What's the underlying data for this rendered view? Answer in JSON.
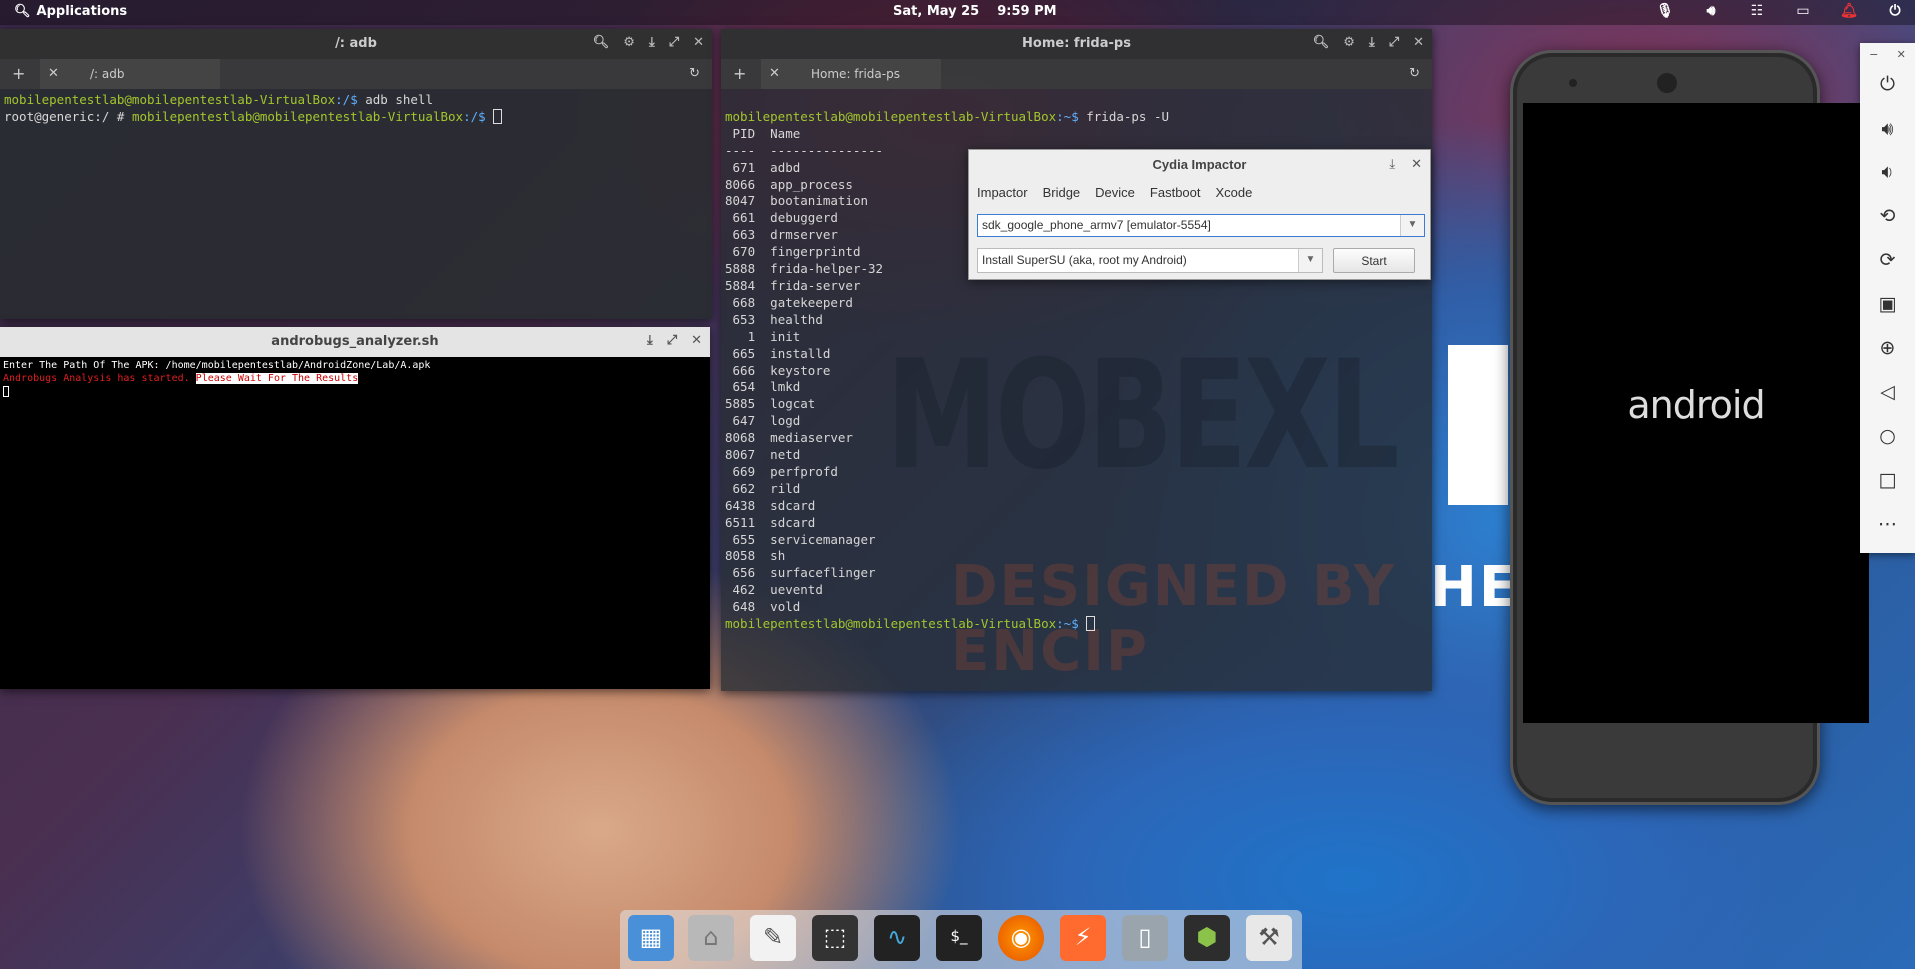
{
  "top_panel": {
    "applications": "Applications",
    "date": "Sat, May 25",
    "time": "9:59 PM",
    "indicators": [
      "mic-icon",
      "volume-icon",
      "network-icon",
      "battery-icon",
      "notifications-icon",
      "power-icon"
    ]
  },
  "adb_window": {
    "title": "/: adb",
    "tab_label": "/: adb",
    "lines": [
      {
        "prompt": "mobilepentestlab@mobilepentestlab-VirtualBox",
        "path": ":/$",
        "cmd": " adb shell"
      },
      {
        "plain": "root@generic:/ # ",
        "prompt": "mobilepentestlab@mobilepentestlab-VirtualBox",
        "path": ":/$",
        "cmd": " "
      }
    ]
  },
  "androbugs_window": {
    "title": "androbugs_analyzer.sh",
    "line1": "Enter The Path Of The APK: /home/mobilepentestlab/AndroidZone/Lab/A.apk",
    "line2_red": "Androbugs Analysis has started.",
    "line2_hl": "Please Wait For The Results"
  },
  "frida_window": {
    "title": "Home: frida-ps",
    "tab_label": "Home: frida-ps",
    "prompt": "mobilepentestlab@mobilepentestlab-VirtualBox",
    "prompt_path": ":~$",
    "command": " frida-ps -U",
    "header": " PID  Name",
    "divider": "----  ---------------",
    "processes": [
      {
        "pid": " 671",
        "name": "adbd"
      },
      {
        "pid": "8066",
        "name": "app_process"
      },
      {
        "pid": "8047",
        "name": "bootanimation"
      },
      {
        "pid": " 661",
        "name": "debuggerd"
      },
      {
        "pid": " 663",
        "name": "drmserver"
      },
      {
        "pid": " 670",
        "name": "fingerprintd"
      },
      {
        "pid": "5888",
        "name": "frida-helper-32"
      },
      {
        "pid": "5884",
        "name": "frida-server"
      },
      {
        "pid": " 668",
        "name": "gatekeeperd"
      },
      {
        "pid": " 653",
        "name": "healthd"
      },
      {
        "pid": "   1",
        "name": "init"
      },
      {
        "pid": " 665",
        "name": "installd"
      },
      {
        "pid": " 666",
        "name": "keystore"
      },
      {
        "pid": " 654",
        "name": "lmkd"
      },
      {
        "pid": "5885",
        "name": "logcat"
      },
      {
        "pid": " 647",
        "name": "logd"
      },
      {
        "pid": "8068",
        "name": "mediaserver"
      },
      {
        "pid": "8067",
        "name": "netd"
      },
      {
        "pid": " 669",
        "name": "perfprofd"
      },
      {
        "pid": " 662",
        "name": "rild"
      },
      {
        "pid": "6438",
        "name": "sdcard"
      },
      {
        "pid": "6511",
        "name": "sdcard"
      },
      {
        "pid": " 655",
        "name": "servicemanager"
      },
      {
        "pid": "8058",
        "name": "sh"
      },
      {
        "pid": " 656",
        "name": "surfaceflinger"
      },
      {
        "pid": " 462",
        "name": "ueventd"
      },
      {
        "pid": " 648",
        "name": "vold"
      }
    ]
  },
  "cydia": {
    "title": "Cydia Impactor",
    "menu": [
      "Impactor",
      "Bridge",
      "Device",
      "Fastboot",
      "Xcode"
    ],
    "device": "sdk_google_phone_armv7 [emulator-5554]",
    "action": "Install SuperSU (aka, root my Android)",
    "start": "Start"
  },
  "wallpaper": {
    "big": "MOBEXL",
    "sub_dark": "DESIGNED BY ENCIP",
    "sub_light": "HE"
  },
  "phone": {
    "logo": "android"
  },
  "dock": [
    "workspace-icon",
    "files-icon",
    "text-editor-icon",
    "screenshot-icon",
    "system-monitor-icon",
    "terminal-icon",
    "firefox-icon",
    "burp-suite-icon",
    "android-emulator-icon",
    "androbugs-icon",
    "drill-icon"
  ]
}
